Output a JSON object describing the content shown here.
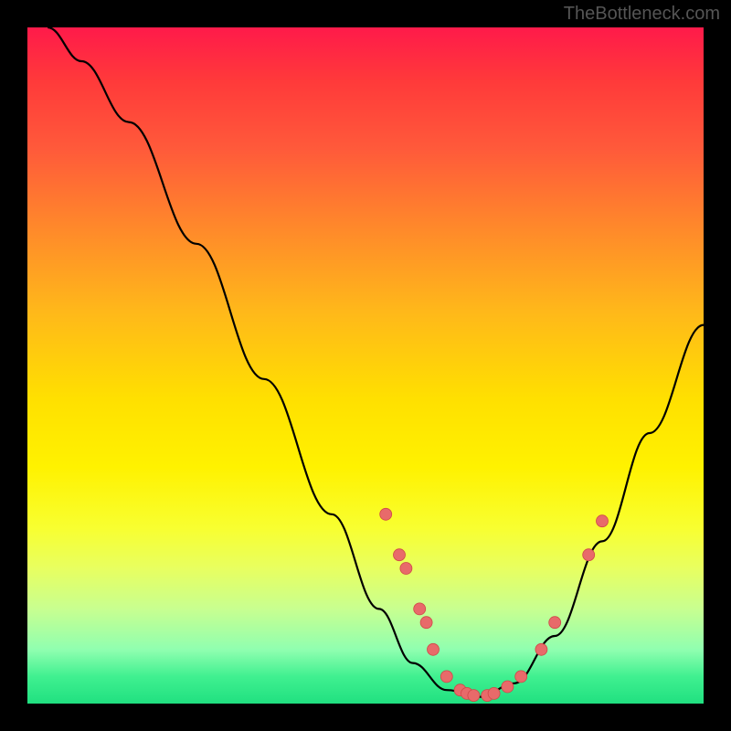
{
  "watermark": "TheBottleneck.com",
  "chart_data": {
    "type": "line",
    "title": "",
    "xlabel": "",
    "ylabel": "",
    "xlim": [
      0,
      100
    ],
    "ylim": [
      0,
      100
    ],
    "curve": [
      {
        "x": 3,
        "y": 100
      },
      {
        "x": 8,
        "y": 95
      },
      {
        "x": 15,
        "y": 86
      },
      {
        "x": 25,
        "y": 68
      },
      {
        "x": 35,
        "y": 48
      },
      {
        "x": 45,
        "y": 28
      },
      {
        "x": 52,
        "y": 14
      },
      {
        "x": 57,
        "y": 6
      },
      {
        "x": 62,
        "y": 2
      },
      {
        "x": 67,
        "y": 1
      },
      {
        "x": 72,
        "y": 3
      },
      {
        "x": 78,
        "y": 10
      },
      {
        "x": 85,
        "y": 24
      },
      {
        "x": 92,
        "y": 40
      },
      {
        "x": 100,
        "y": 56
      }
    ],
    "dots": [
      {
        "x": 53,
        "y": 28
      },
      {
        "x": 55,
        "y": 22
      },
      {
        "x": 56,
        "y": 20
      },
      {
        "x": 58,
        "y": 14
      },
      {
        "x": 59,
        "y": 12
      },
      {
        "x": 60,
        "y": 8
      },
      {
        "x": 62,
        "y": 4
      },
      {
        "x": 64,
        "y": 2
      },
      {
        "x": 65,
        "y": 1.5
      },
      {
        "x": 66,
        "y": 1.2
      },
      {
        "x": 68,
        "y": 1.2
      },
      {
        "x": 69,
        "y": 1.5
      },
      {
        "x": 71,
        "y": 2.5
      },
      {
        "x": 73,
        "y": 4
      },
      {
        "x": 76,
        "y": 8
      },
      {
        "x": 78,
        "y": 12
      },
      {
        "x": 83,
        "y": 22
      },
      {
        "x": 85,
        "y": 27
      }
    ],
    "gradient_stops": [
      {
        "pos": 0,
        "color": "#ff1a4a"
      },
      {
        "pos": 55,
        "color": "#ffe000"
      },
      {
        "pos": 100,
        "color": "#20e080"
      }
    ]
  }
}
